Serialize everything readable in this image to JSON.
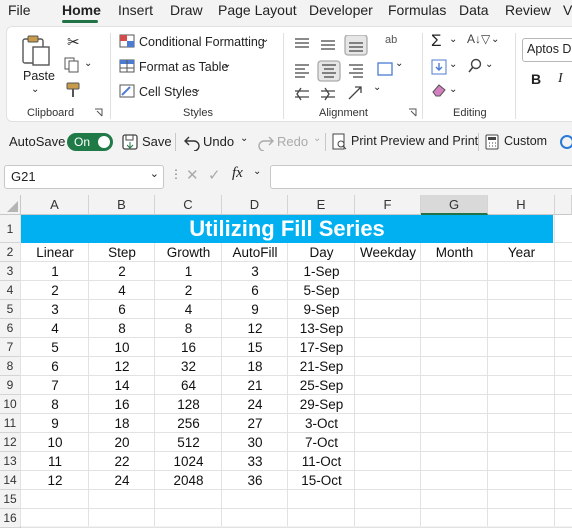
{
  "menu": {
    "tabs": [
      "File",
      "Home",
      "Insert",
      "Draw",
      "Page Layout",
      "Developer",
      "Formulas",
      "Data",
      "Review",
      "V"
    ],
    "active": "Home"
  },
  "ribbon": {
    "clipboard": {
      "paste": "Paste",
      "label": "Clipboard"
    },
    "styles": {
      "conditional": "Conditional Formatting",
      "format_table": "Format as Table",
      "cell_styles": "Cell Styles",
      "label": "Styles"
    },
    "alignment": {
      "label": "Alignment"
    },
    "editing": {
      "label": "Editing"
    },
    "font": {
      "name": "Aptos Di",
      "bold": "B",
      "italic": "I"
    }
  },
  "qat": {
    "autosave": "AutoSave",
    "toggle": "On",
    "save": "Save",
    "undo": "Undo",
    "redo": "Redo",
    "print_preview": "Print Preview and Print",
    "custom": "Custom"
  },
  "formula_bar": {
    "name_box": "G21",
    "fx": "fx",
    "formula": ""
  },
  "sheet": {
    "selected_column": "G",
    "selected_row": "21",
    "columns": [
      "A",
      "B",
      "C",
      "D",
      "E",
      "F",
      "G",
      "H"
    ],
    "row_numbers": [
      "1",
      "2",
      "3",
      "4",
      "5",
      "6",
      "7",
      "8",
      "9",
      "10",
      "11",
      "12",
      "13",
      "14",
      "15",
      "16"
    ],
    "title": "Utilizing Fill Series",
    "headers": [
      "Linear",
      "Step",
      "Growth",
      "AutoFill",
      "Day",
      "Weekday",
      "Month",
      "Year"
    ],
    "rows": [
      [
        "1",
        "2",
        "1",
        "3",
        "1-Sep"
      ],
      [
        "2",
        "4",
        "2",
        "6",
        "5-Sep"
      ],
      [
        "3",
        "6",
        "4",
        "9",
        "9-Sep"
      ],
      [
        "4",
        "8",
        "8",
        "12",
        "13-Sep"
      ],
      [
        "5",
        "10",
        "16",
        "15",
        "17-Sep"
      ],
      [
        "6",
        "12",
        "32",
        "18",
        "21-Sep"
      ],
      [
        "7",
        "14",
        "64",
        "21",
        "25-Sep"
      ],
      [
        "8",
        "16",
        "128",
        "24",
        "29-Sep"
      ],
      [
        "9",
        "18",
        "256",
        "27",
        "3-Oct"
      ],
      [
        "10",
        "20",
        "512",
        "30",
        "7-Oct"
      ],
      [
        "11",
        "22",
        "1024",
        "33",
        "11-Oct"
      ],
      [
        "12",
        "24",
        "2048",
        "36",
        "15-Oct"
      ]
    ],
    "title_fill": "#00b0f0",
    "accent": "#217346"
  }
}
